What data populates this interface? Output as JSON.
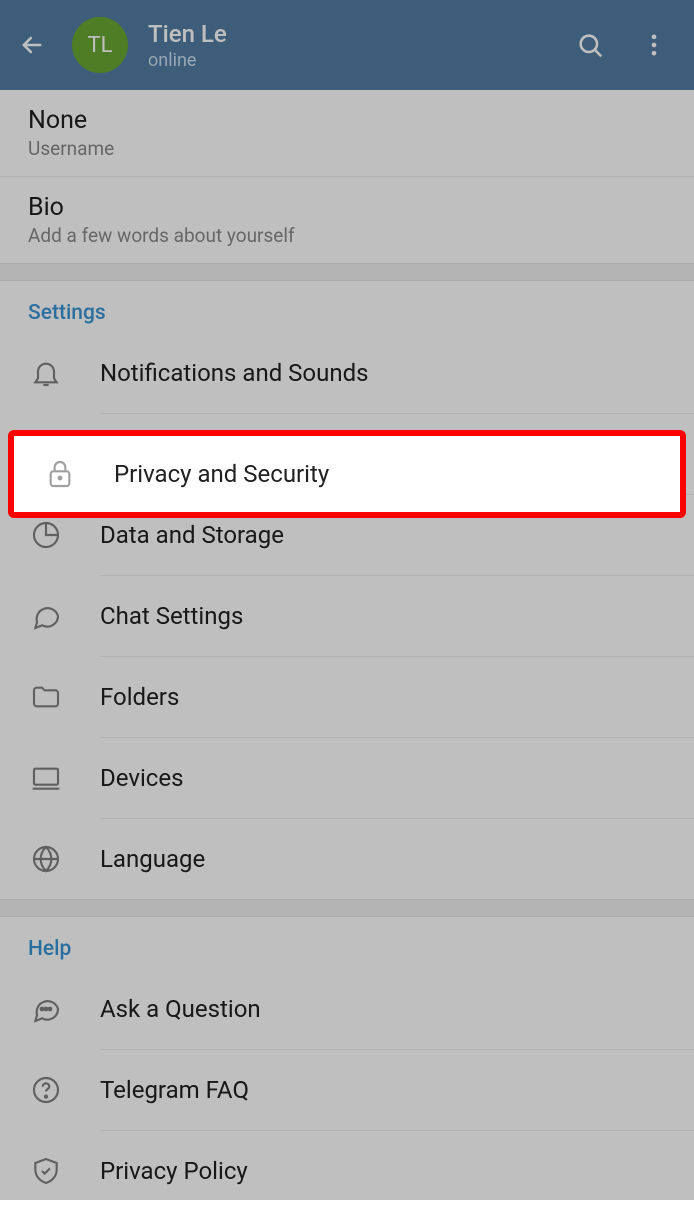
{
  "header": {
    "avatar_initials": "TL",
    "name": "Tien Le",
    "status": "online"
  },
  "profile": {
    "username_value": "None",
    "username_label": "Username",
    "bio_title": "Bio",
    "bio_sub": "Add a few words about yourself"
  },
  "sections": {
    "settings_header": "Settings",
    "help_header": "Help"
  },
  "settings": {
    "notifications": "Notifications and Sounds",
    "privacy": "Privacy and Security",
    "data": "Data and Storage",
    "chat": "Chat Settings",
    "folders": "Folders",
    "devices": "Devices",
    "language": "Language"
  },
  "help": {
    "ask": "Ask a Question",
    "faq": "Telegram FAQ",
    "privacy_policy": "Privacy Policy"
  },
  "highlighted_item": "privacy"
}
